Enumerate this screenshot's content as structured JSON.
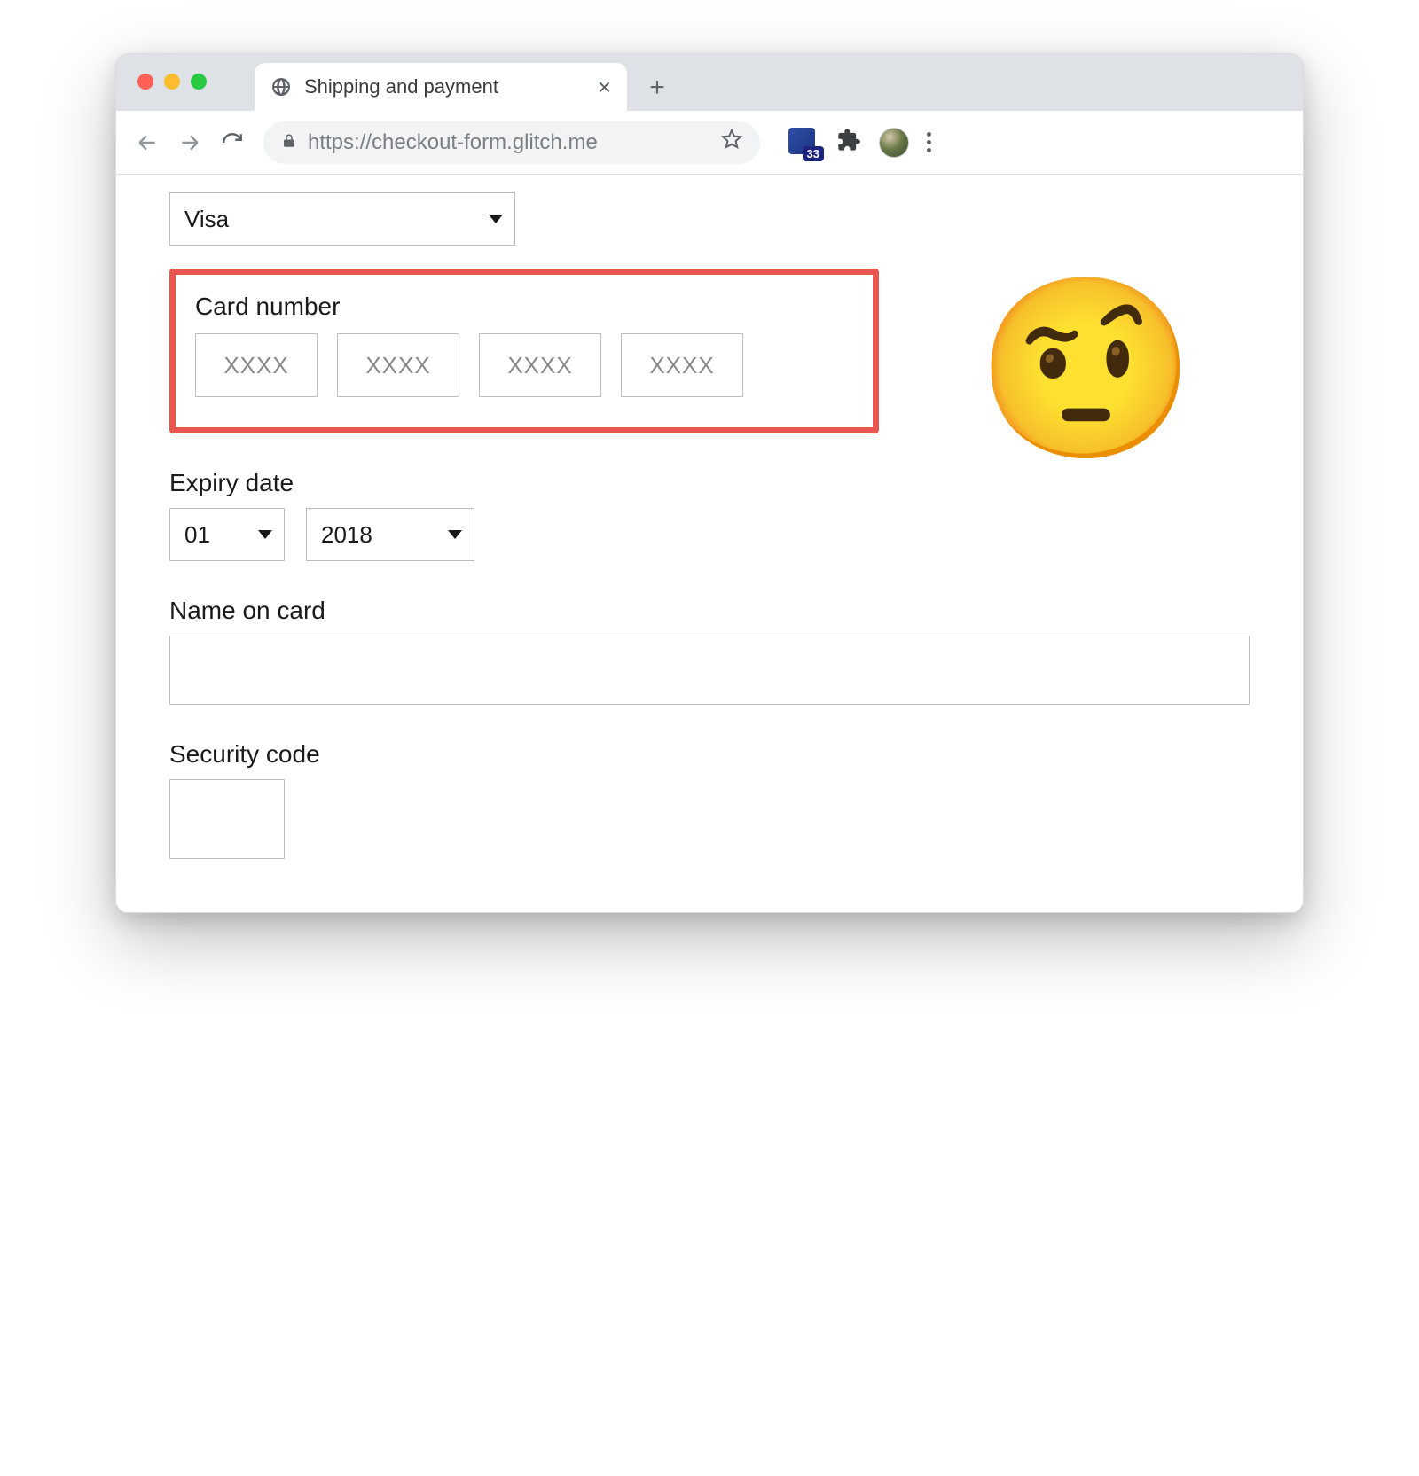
{
  "browser": {
    "tab_title": "Shipping and payment",
    "url": "https://checkout-form.glitch.me",
    "extension_badge": "33"
  },
  "form": {
    "card_type": {
      "value": "Visa"
    },
    "card_number": {
      "label": "Card number",
      "placeholder": "XXXX"
    },
    "expiry": {
      "label": "Expiry date",
      "month": "01",
      "year": "2018"
    },
    "name": {
      "label": "Name on card",
      "value": ""
    },
    "cvv": {
      "label": "Security code",
      "value": ""
    }
  },
  "annotation": {
    "emoji": "🤨",
    "highlight_color": "#e8564f"
  }
}
